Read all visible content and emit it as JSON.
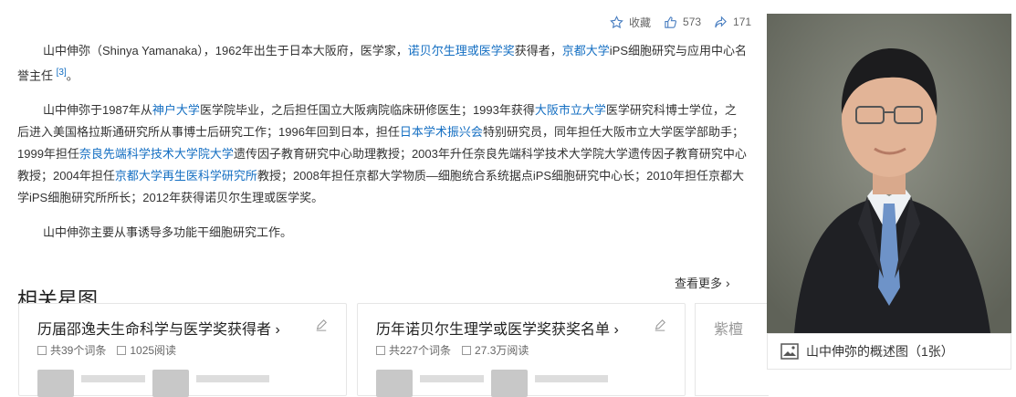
{
  "toolbar": {
    "collect_label": "收藏",
    "like_count": "573",
    "share_count": "171"
  },
  "article": {
    "p1": {
      "prefix": "山中伸弥（Shinya Yamanaka），1962年出生于日本大阪府，医学家，",
      "link1": "诺贝尔生理或医学奖",
      "mid": "获得者，",
      "link2": "京都大学",
      "suffix": "iPS细胞研究与应用中心名誉主任",
      "ref": "[3]",
      "end": "。"
    },
    "p2": {
      "t1": "山中伸弥于1987年从",
      "l1": "神户大学",
      "t2": "医学院毕业，之后担任国立大阪病院临床研修医生；1993年获得",
      "l2": "大阪市立大学",
      "t3": "医学研究科博士学位，之后进入美国格拉斯通研究所从事博士后研究工作；1996年回到日本，担任",
      "l3": "日本学术振兴会",
      "t4": "特别研究员，同年担任大阪市立大学医学部助手；1999年担任",
      "l4": "奈良先端科学技术大学院大学",
      "t5": "遗传因子教育研究中心助理教授；2003年升任奈良先端科学技术大学院大学遗传因子教育研究中心教授；2004年担任",
      "l5": "京都大学再生医科学研究所",
      "t6": "教授；2008年担任京都大学物质—细胞统合系统据点iPS细胞研究中心长；2010年担任京都大学iPS细胞研究所所长；2012年获得诺贝尔生理或医学奖。"
    },
    "p3": "山中伸弥主要从事诱导多功能干细胞研究工作。"
  },
  "related": {
    "title": "相关星图",
    "more_label": "查看更多",
    "cards": [
      {
        "title": "历届邵逸夫生命科学与医学奖获得者",
        "terms": "共39个词条",
        "reads": "1025阅读"
      },
      {
        "title": "历年诺贝尔生理学或医学奖获奖名单",
        "terms": "共227个词条",
        "reads": "27.3万阅读"
      }
    ],
    "card3_title": "紫檀"
  },
  "photo": {
    "caption": "山中伸弥的概述图（1张）"
  },
  "colors": {
    "link": "#136ec2",
    "text": "#333333"
  }
}
